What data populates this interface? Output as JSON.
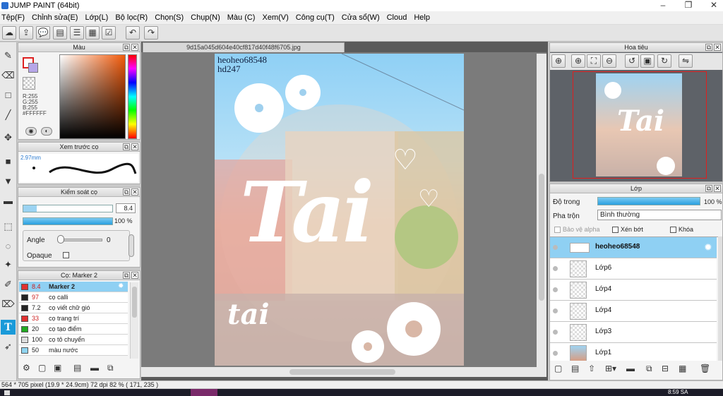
{
  "window": {
    "title": "JUMP PAINT (64bit)",
    "minimize": "–",
    "maximize": "❐",
    "close": "✕"
  },
  "menu": [
    "Tệp(F)",
    "Chỉnh sửa(E)",
    "Lớp(L)",
    "Bộ lọc(R)",
    "Chọn(S)",
    "Chụp(N)",
    "Màu (C)",
    "Xem(V)",
    "Công cụ(T)",
    "Cửa sổ(W)",
    "Cloud",
    "Help"
  ],
  "color_panel": {
    "title": "Màu",
    "r": "R:255",
    "g": "G:255",
    "b": "B:255",
    "hex": "#FFFFFF"
  },
  "brush_preview": {
    "title": "Xem trước cọ",
    "size": "2.97mm"
  },
  "brush_control": {
    "title": "Kiểm soát cọ",
    "size_value": "8.4",
    "opacity_value": "100 %",
    "angle_label": "Angle",
    "angle_value": "0",
    "opaque_label": "Opaque"
  },
  "brush_list": {
    "title": "Cọ: Marker 2",
    "items": [
      {
        "size": "8.4",
        "name": "Marker 2",
        "color": "#e03030",
        "selected": true
      },
      {
        "size": "97",
        "name": "cọ calli",
        "color": "#222222"
      },
      {
        "size": "7.2",
        "name": "cọ viết chữ gió",
        "color": "#222222"
      },
      {
        "size": "33",
        "name": "cọ trang trí",
        "color": "#e03030"
      },
      {
        "size": "20",
        "name": "cọ tạo điểm",
        "color": "#22aa22"
      },
      {
        "size": "100",
        "name": "cọ tô chuyển",
        "color": "#dddddd"
      },
      {
        "size": "50",
        "name": "màu nước",
        "color": "#8fd4f0"
      }
    ]
  },
  "document": {
    "filename": "9d15a045d604e40cf817d40f48f6705.jpg",
    "watermark_line1": "heoheo68548",
    "watermark_line2": "hd247",
    "big_text": "Tai",
    "small_text": "tai"
  },
  "navigator": {
    "title": "Hoa tiêu"
  },
  "layers_panel": {
    "title": "Lớp",
    "opacity_label": "Độ trong",
    "opacity_value": "100 %",
    "blend_label": "Pha trộn",
    "blend_value": "Bình thường",
    "protect_alpha": "Bảo vệ alpha",
    "clip": "Xén bớt",
    "lock": "Khóa",
    "layers": [
      {
        "name": "heoheo68548",
        "selected": true
      },
      {
        "name": "Lớp6"
      },
      {
        "name": "Lớp4"
      },
      {
        "name": "Lớp4"
      },
      {
        "name": "Lớp3"
      },
      {
        "name": "Lớp1"
      }
    ]
  },
  "status": {
    "text": "564 * 705 pixel  (19.9 * 24.9cm)  72 dpi  82 %  ( 171, 235 )"
  },
  "taskbar": {
    "time": "8:59 SA"
  },
  "colors": {
    "accent": "#1a9ad9",
    "selected_row": "#8fd0f3"
  }
}
